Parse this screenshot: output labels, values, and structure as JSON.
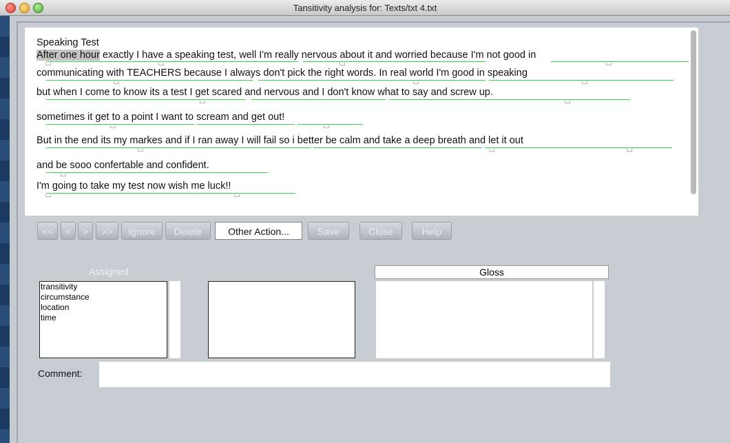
{
  "window": {
    "title": "Tansitivity analysis for: Texts/txt 4.txt"
  },
  "text": {
    "heading": "Speaking Test",
    "line1_highlight": "After one hour",
    "line1_rest": " exactly I have a speaking test, well I'm really nervous about it and worried because I'm not good in",
    "line2": "communicating with TEACHERS because I always don't pick the right words. In real world I'm good in speaking",
    "line3": "but when I come to know its a test I get scared and nervous and I don't know what to say and screw up.",
    "line4": "sometimes it get to a point I want to scream and get out!",
    "line5": "But in the end its my markes and if I ran away I will fail so i better be calm and take a deep breath and let it out",
    "line6": "and be sooo confertable and confident.",
    "line7": "I'm going to take my test now wish me luck!!"
  },
  "toolbar": {
    "first": "<<",
    "prev": "<",
    "next": ">",
    "last": ">>",
    "ignore": "Ignore",
    "delete": "Delete",
    "other_action": "Other Action...",
    "save": "Save",
    "close": "Close",
    "help": "Help"
  },
  "assigned": {
    "label": "Assigned",
    "items": [
      "transitivity",
      "circumstance",
      "location",
      "time"
    ]
  },
  "gloss": {
    "label": "Gloss"
  },
  "comment": {
    "label": "Comment:",
    "value": ""
  }
}
